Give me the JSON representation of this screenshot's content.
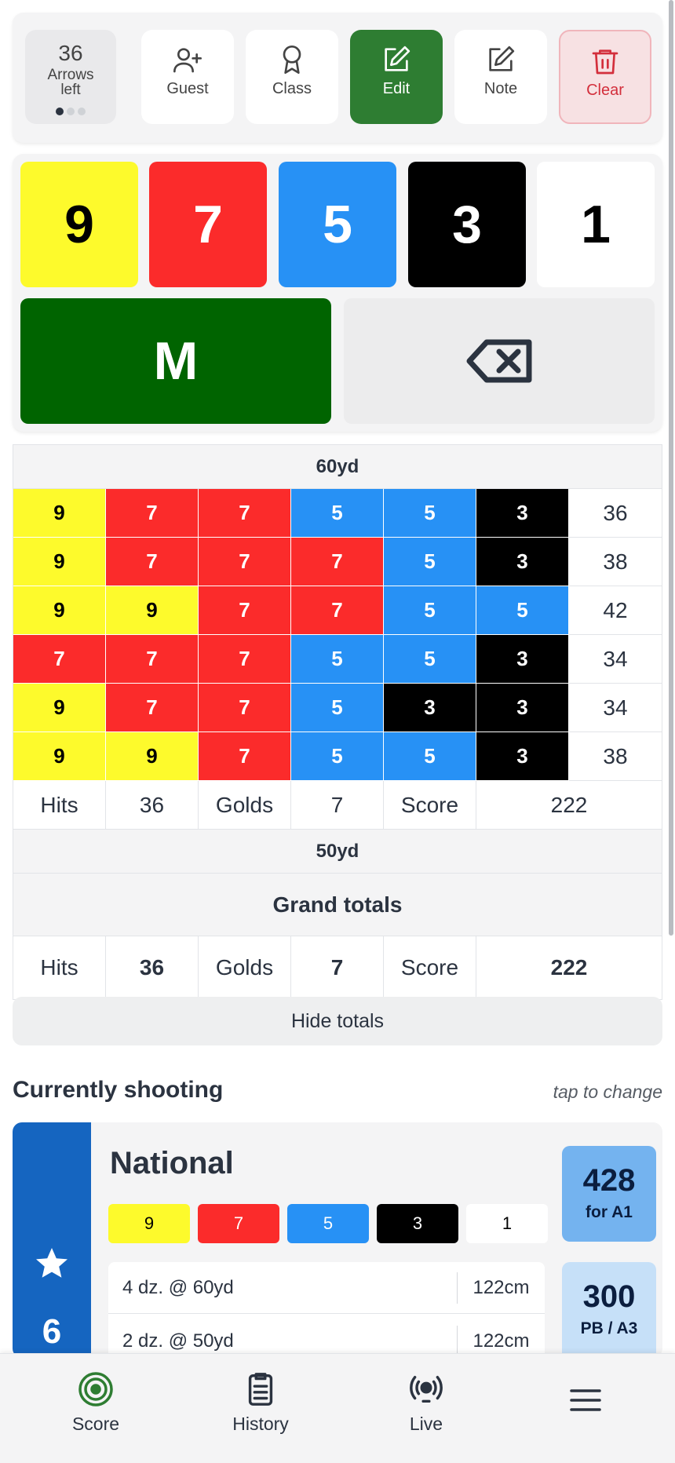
{
  "toolbar": {
    "arrows_left_count": "36",
    "arrows_left_label": "Arrows left",
    "buttons": [
      {
        "label": "Guest",
        "icon": "user-plus-icon"
      },
      {
        "label": "Class",
        "icon": "ribbon-icon"
      },
      {
        "label": "Edit",
        "icon": "edit-icon"
      },
      {
        "label": "Note",
        "icon": "edit-icon"
      },
      {
        "label": "Clear",
        "icon": "trash-icon"
      }
    ]
  },
  "keypad": {
    "keys": [
      "9",
      "7",
      "5",
      "3",
      "1",
      "M"
    ],
    "colors": {
      "gold": "#fdfa2c",
      "red": "#fb2b2b",
      "blue": "#2791f5",
      "black": "#000000",
      "white": "#ffffff",
      "miss": "#006400"
    }
  },
  "scoresheet": {
    "distance_60": "60yd",
    "rows": [
      {
        "arrows": [
          "9",
          "7",
          "7",
          "5",
          "5",
          "3"
        ],
        "total": "36"
      },
      {
        "arrows": [
          "9",
          "7",
          "7",
          "7",
          "5",
          "3"
        ],
        "total": "38"
      },
      {
        "arrows": [
          "9",
          "9",
          "7",
          "7",
          "5",
          "5"
        ],
        "total": "42"
      },
      {
        "arrows": [
          "7",
          "7",
          "7",
          "5",
          "5",
          "3"
        ],
        "total": "34"
      },
      {
        "arrows": [
          "9",
          "7",
          "7",
          "5",
          "3",
          "3"
        ],
        "total": "34"
      },
      {
        "arrows": [
          "9",
          "9",
          "7",
          "5",
          "5",
          "3"
        ],
        "total": "38"
      }
    ],
    "summary": {
      "hits_label": "Hits",
      "hits": "36",
      "golds_label": "Golds",
      "golds": "7",
      "score_label": "Score",
      "score": "222"
    },
    "distance_50": "50yd",
    "grand_title": "Grand totals",
    "grand": {
      "hits_label": "Hits",
      "hits": "36",
      "golds_label": "Golds",
      "golds": "7",
      "score_label": "Score",
      "score": "222"
    },
    "hide_totals": "Hide totals"
  },
  "currently_shooting": {
    "title": "Currently shooting",
    "hint": "tap to change",
    "round": {
      "name": "National",
      "count": "6",
      "chips": [
        "9",
        "7",
        "5",
        "3",
        "1"
      ],
      "distances": [
        {
          "dozens": "4 dz. @ 60yd",
          "face": "122cm"
        },
        {
          "dozens": "2 dz. @ 50yd",
          "face": "122cm"
        }
      ],
      "target": {
        "value": "428",
        "label": "for A1"
      },
      "pb": {
        "value": "300",
        "label": "PB / A3"
      }
    }
  },
  "nav": {
    "items": [
      {
        "label": "Score",
        "icon": "target-icon"
      },
      {
        "label": "History",
        "icon": "clipboard-icon"
      },
      {
        "label": "Live",
        "icon": "broadcast-icon"
      },
      {
        "label": "",
        "icon": "menu-icon"
      }
    ]
  }
}
